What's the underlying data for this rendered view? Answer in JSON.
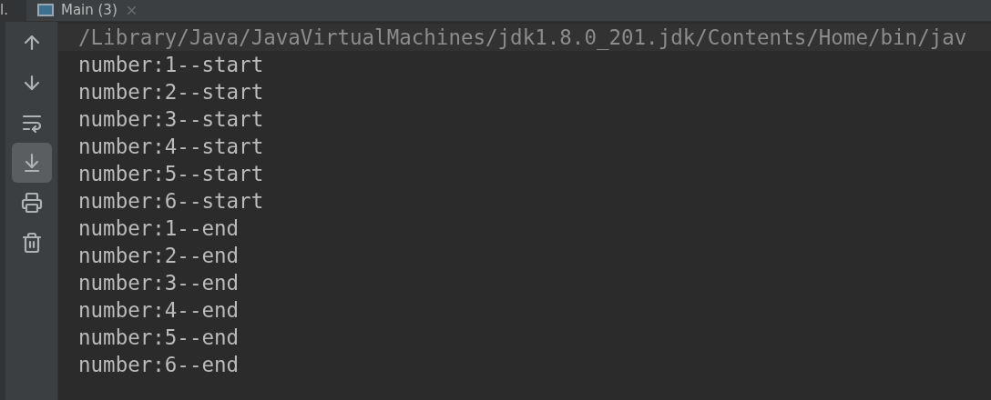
{
  "tabs": [
    {
      "label": "l.",
      "selected": false
    },
    {
      "label": "Main (3)",
      "selected": true
    }
  ],
  "toolbar": [
    {
      "kind": "up",
      "selected": false
    },
    {
      "kind": "down",
      "selected": false
    },
    {
      "kind": "wrap",
      "selected": false
    },
    {
      "kind": "scroll-end",
      "selected": true
    },
    {
      "kind": "print",
      "selected": false
    },
    {
      "kind": "trash",
      "selected": false
    }
  ],
  "console": {
    "lines": [
      {
        "text": "/Library/Java/JavaVirtualMachines/jdk1.8.0_201.jdk/Contents/Home/bin/jav",
        "kind": "command"
      },
      {
        "text": "number:1--start",
        "kind": "output"
      },
      {
        "text": "number:2--start",
        "kind": "output"
      },
      {
        "text": "number:3--start",
        "kind": "output"
      },
      {
        "text": "number:4--start",
        "kind": "output"
      },
      {
        "text": "number:5--start",
        "kind": "output"
      },
      {
        "text": "number:6--start",
        "kind": "output"
      },
      {
        "text": "number:1--end",
        "kind": "output"
      },
      {
        "text": "number:2--end",
        "kind": "output"
      },
      {
        "text": "number:3--end",
        "kind": "output"
      },
      {
        "text": "number:4--end",
        "kind": "output"
      },
      {
        "text": "number:5--end",
        "kind": "output"
      },
      {
        "text": "number:6--end",
        "kind": "output"
      }
    ]
  }
}
